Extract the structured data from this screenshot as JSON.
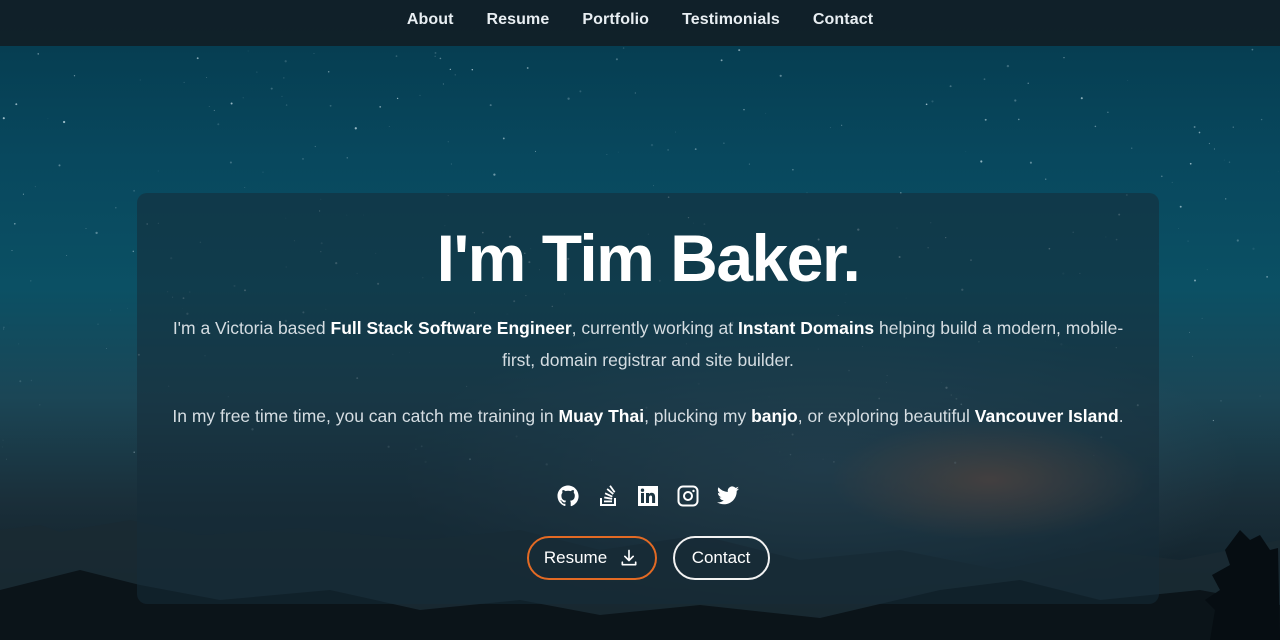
{
  "nav": {
    "items": [
      {
        "label": "About"
      },
      {
        "label": "Resume"
      },
      {
        "label": "Portfolio"
      },
      {
        "label": "Testimonials"
      },
      {
        "label": "Contact"
      }
    ]
  },
  "hero": {
    "title": "I'm Tim Baker.",
    "para1": {
      "t1": "I'm a Victoria based ",
      "b1": "Full Stack Software Engineer",
      "t2": ", currently working at ",
      "b2": "Instant Domains",
      "t3": " helping build a modern, mobile-first, domain registrar and site builder."
    },
    "para2": {
      "t1": "In my free time time, you can catch me training in ",
      "b1": "Muay Thai",
      "t2": ", plucking my ",
      "b2": "banjo",
      "t3": ", or exploring beautiful ",
      "b3": "Vancouver Island",
      "t4": "."
    },
    "socials": [
      {
        "icon": "github-icon"
      },
      {
        "icon": "stackoverflow-icon"
      },
      {
        "icon": "linkedin-icon"
      },
      {
        "icon": "instagram-icon"
      },
      {
        "icon": "twitter-icon"
      }
    ],
    "buttons": {
      "resume_label": "Resume",
      "resume_icon": "download-icon",
      "contact_label": "Contact"
    }
  },
  "colors": {
    "accent": "#e36a24",
    "nav_bg": "#111e26",
    "text": "#ffffff"
  }
}
